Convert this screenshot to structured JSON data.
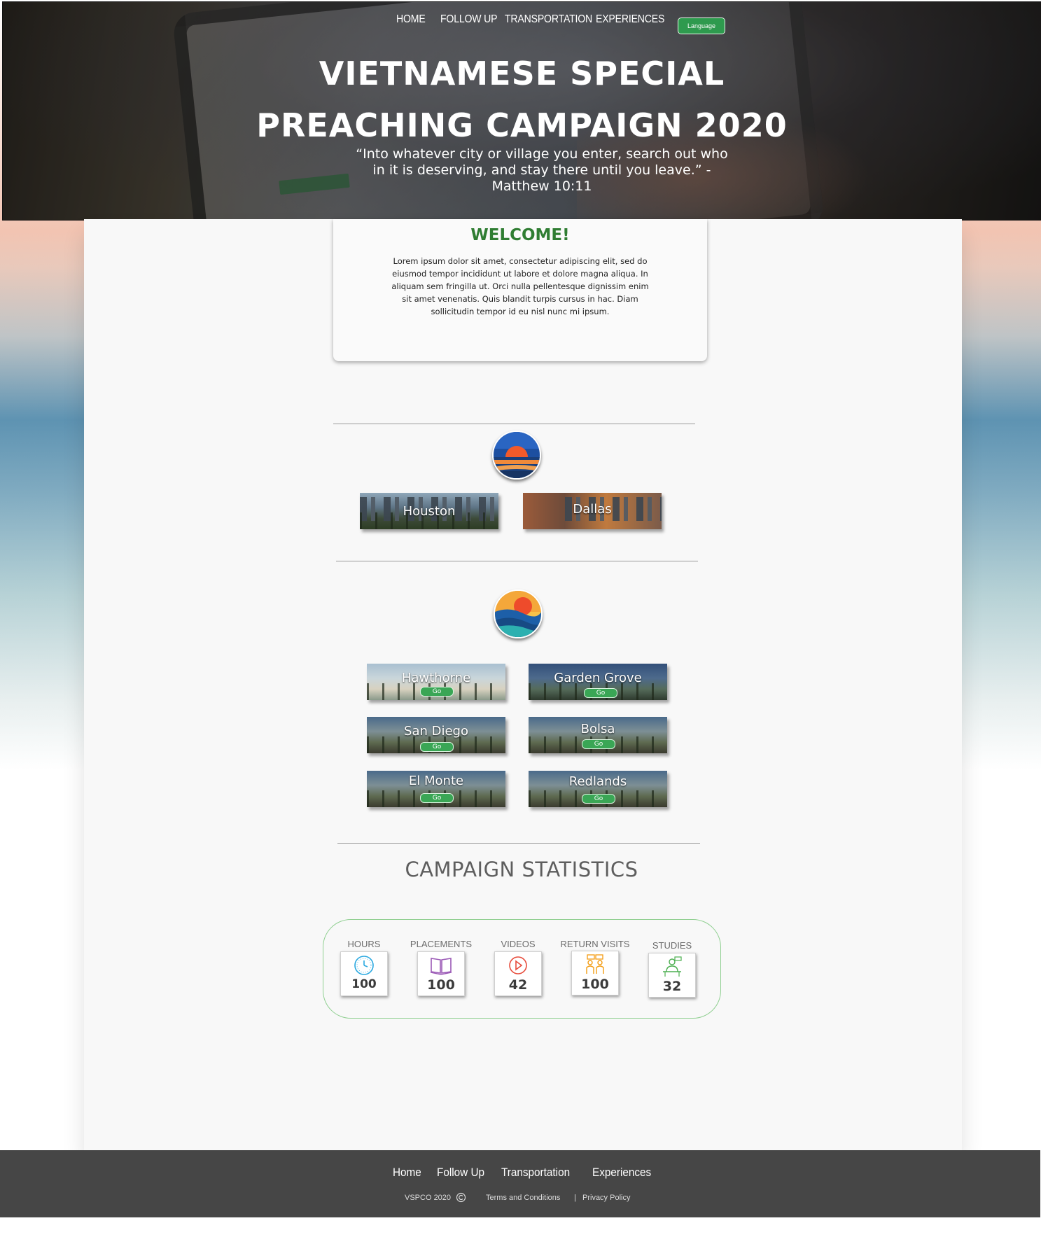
{
  "nav": {
    "items": [
      "HOME",
      "FOLLOW UP",
      "TRANSPORTATION",
      "EXPERIENCES"
    ],
    "language_label": "Language"
  },
  "hero": {
    "title_line1": "VIETNAMESE SPECIAL",
    "title_line2": "PREACHING CAMPAIGN 2020",
    "quote": "“Into whatever city or village you enter, search out who in it is deserving, and stay there until you leave.” - Matthew 10:11"
  },
  "welcome": {
    "title": "WELCOME!",
    "body": "Lorem ipsum dolor sit amet, consectetur adipiscing elit, sed do eiusmod tempor incididunt ut labore et dolore magna aliqua. In aliquam sem fringilla ut. Orci nulla pellentesque dignissim enim sit amet venenatis. Quis blandit turpis cursus in hac. Diam sollicitudin tempor id eu nisl nunc mi ipsum."
  },
  "region_texas": {
    "cities": [
      "Houston",
      "Dallas"
    ]
  },
  "region_california": {
    "go_label": "Go",
    "cities": [
      "Hawthorne",
      "Garden Grove",
      "San Diego",
      "Bolsa",
      "El Monte",
      "Redlands"
    ]
  },
  "stats": {
    "title": "CAMPAIGN STATISTICS",
    "items": [
      {
        "label": "HOURS",
        "value": "100",
        "icon": "clock-icon",
        "color": "#29a8e0"
      },
      {
        "label": "PLACEMENTS",
        "value": "100",
        "icon": "book-icon",
        "color": "#9b59b6"
      },
      {
        "label": "VIDEOS",
        "value": "42",
        "icon": "play-icon",
        "color": "#e74c3c"
      },
      {
        "label": "RETURN VISITS",
        "value": "100",
        "icon": "people-talking-icon",
        "color": "#f39c12"
      },
      {
        "label": "STUDIES",
        "value": "32",
        "icon": "study-icon",
        "color": "#4caf50"
      }
    ]
  },
  "footer": {
    "nav": [
      "Home",
      "Follow Up",
      "Transportation",
      "Experiences"
    ],
    "copyright": "VSPCO 2020",
    "terms": "Terms and Conditions",
    "separator": "|",
    "privacy": "Privacy Policy"
  },
  "colors": {
    "accent_green": "#2f7d32",
    "button_green": "#3aa655",
    "footer_bg": "#464646"
  }
}
